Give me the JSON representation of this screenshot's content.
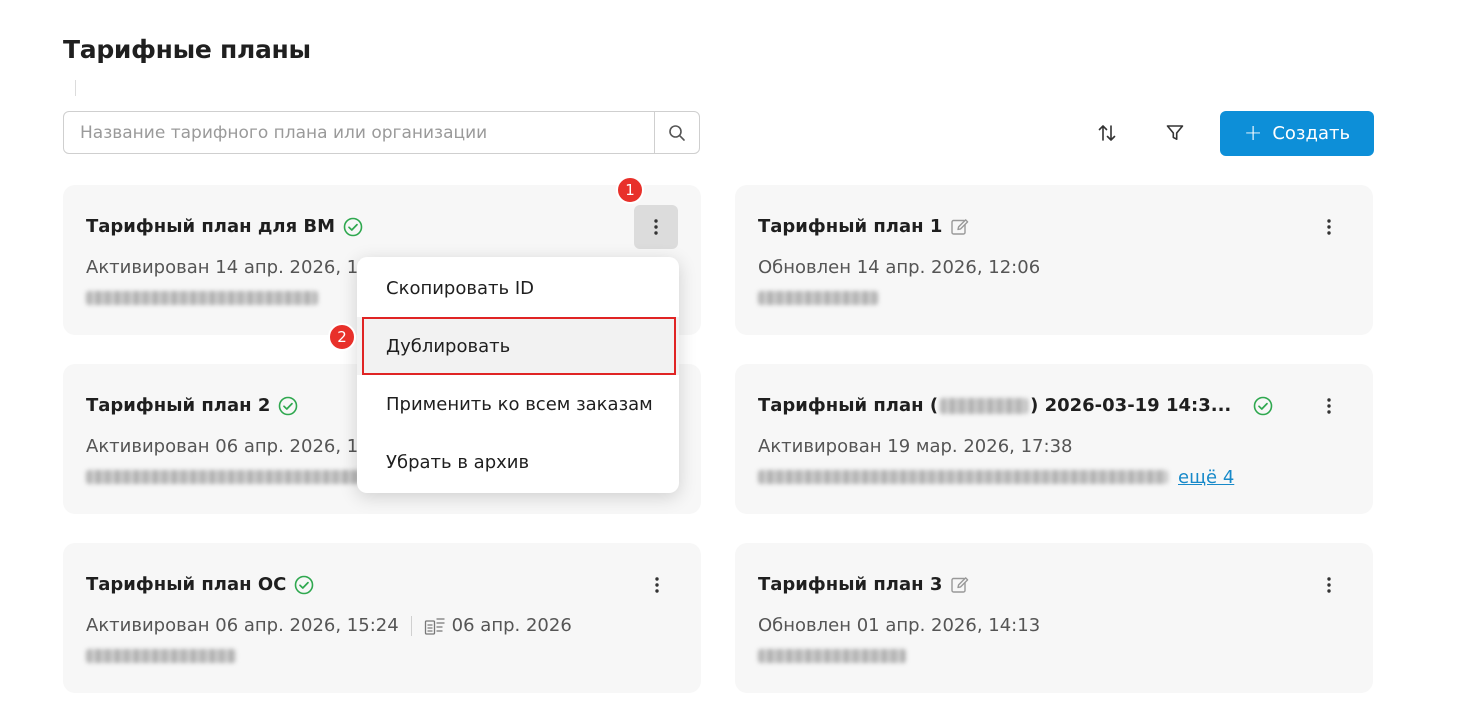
{
  "page": {
    "title": "Тарифные планы"
  },
  "search": {
    "placeholder": "Название тарифного плана или организации"
  },
  "toolbar": {
    "create_label": "Создать"
  },
  "colors": {
    "primary": "#0d8fd8",
    "success": "#2fa84f",
    "annotation": "#e02424"
  },
  "cards": [
    {
      "title": "Тарифный план для ВМ",
      "status_icon": "check-circle-icon",
      "line": "Активирован 14 апр. 2026, 17"
    },
    {
      "title": "Тарифный план 1",
      "status_icon": "edit-icon",
      "line": "Обновлен 14 апр. 2026, 12:06"
    },
    {
      "title": "Тарифный план 2",
      "status_icon": "check-circle-icon",
      "line": "Активирован 06 апр. 2026, 1"
    },
    {
      "title": "Тарифный план (",
      "title_suffix": ") 2026-03-19 14:3...",
      "status_icon": "check-circle-icon",
      "line": "Активирован 19 мар. 2026, 17:38",
      "more_link": "ещё 4"
    },
    {
      "title": "Тарифный план ОС",
      "status_icon": "check-circle-icon",
      "line": "Активирован 06 апр. 2026, 15:24",
      "secondary_date": "06 апр. 2026"
    },
    {
      "title": "Тарифный план 3",
      "status_icon": "edit-icon",
      "line": "Обновлен 01 апр. 2026, 14:13"
    }
  ],
  "context_menu": {
    "items": [
      {
        "label": "Скопировать ID"
      },
      {
        "label": "Дублировать"
      },
      {
        "label": "Применить ко всем заказам"
      },
      {
        "label": "Убрать в архив"
      }
    ]
  },
  "annotations": {
    "step1": "1",
    "step2": "2"
  }
}
